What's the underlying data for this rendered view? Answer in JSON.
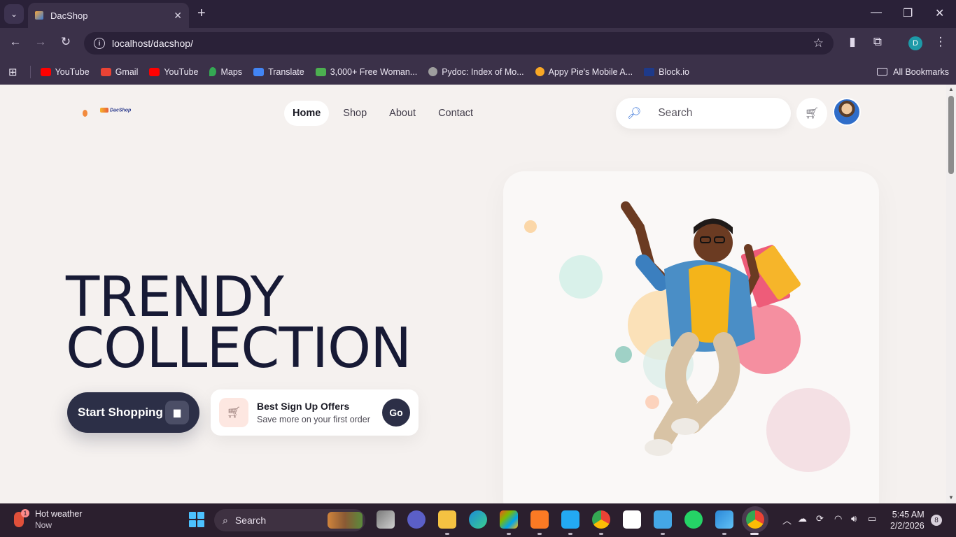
{
  "browser": {
    "tab_title": "DacShop",
    "new_tab_symbol": "+",
    "close_tab_symbol": "✕",
    "url": "localhost/dacshop/",
    "profile_initial": "D",
    "bookmarks": [
      {
        "label": "YouTube",
        "color": "#ff0000"
      },
      {
        "label": "Gmail",
        "color": "#ea4335"
      },
      {
        "label": "YouTube",
        "color": "#ff0000"
      },
      {
        "label": "Maps",
        "color": "#34a853"
      },
      {
        "label": "Translate",
        "color": "#4285f4"
      },
      {
        "label": "3,000+ Free Woman...",
        "color": "#4caf50"
      },
      {
        "label": "Pydoc: Index of Mo...",
        "color": "#9e9e9e"
      },
      {
        "label": "Appy Pie's Mobile A...",
        "color": "#f9a825"
      },
      {
        "label": "Block.io",
        "color": "#1e3a8a"
      }
    ],
    "all_bookmarks": "All Bookmarks"
  },
  "site": {
    "logo_text": "DacShop",
    "nav": [
      {
        "label": "Home",
        "active": true
      },
      {
        "label": "Shop",
        "active": false
      },
      {
        "label": "About",
        "active": false
      },
      {
        "label": "Contact",
        "active": false
      }
    ],
    "search_placeholder": "Search",
    "hero": {
      "title_line1": "TRENDY",
      "title_line2": "COLLECTION",
      "cta_label": "Start Shopping",
      "offer_title": "Best Sign Up Offers",
      "offer_subtitle": "Save more on your first order",
      "offer_go": "Go"
    }
  },
  "taskbar": {
    "weather_title": "Hot weather",
    "weather_time": "Now",
    "weather_badge": "1",
    "search_label": "Search",
    "time": "5:45 AM",
    "date": "2/2/2026",
    "notifications": "8"
  },
  "colors": {
    "accent_dark": "#2c2f47",
    "hero_text": "#171a35",
    "page_bg": "#f5f1ef"
  }
}
